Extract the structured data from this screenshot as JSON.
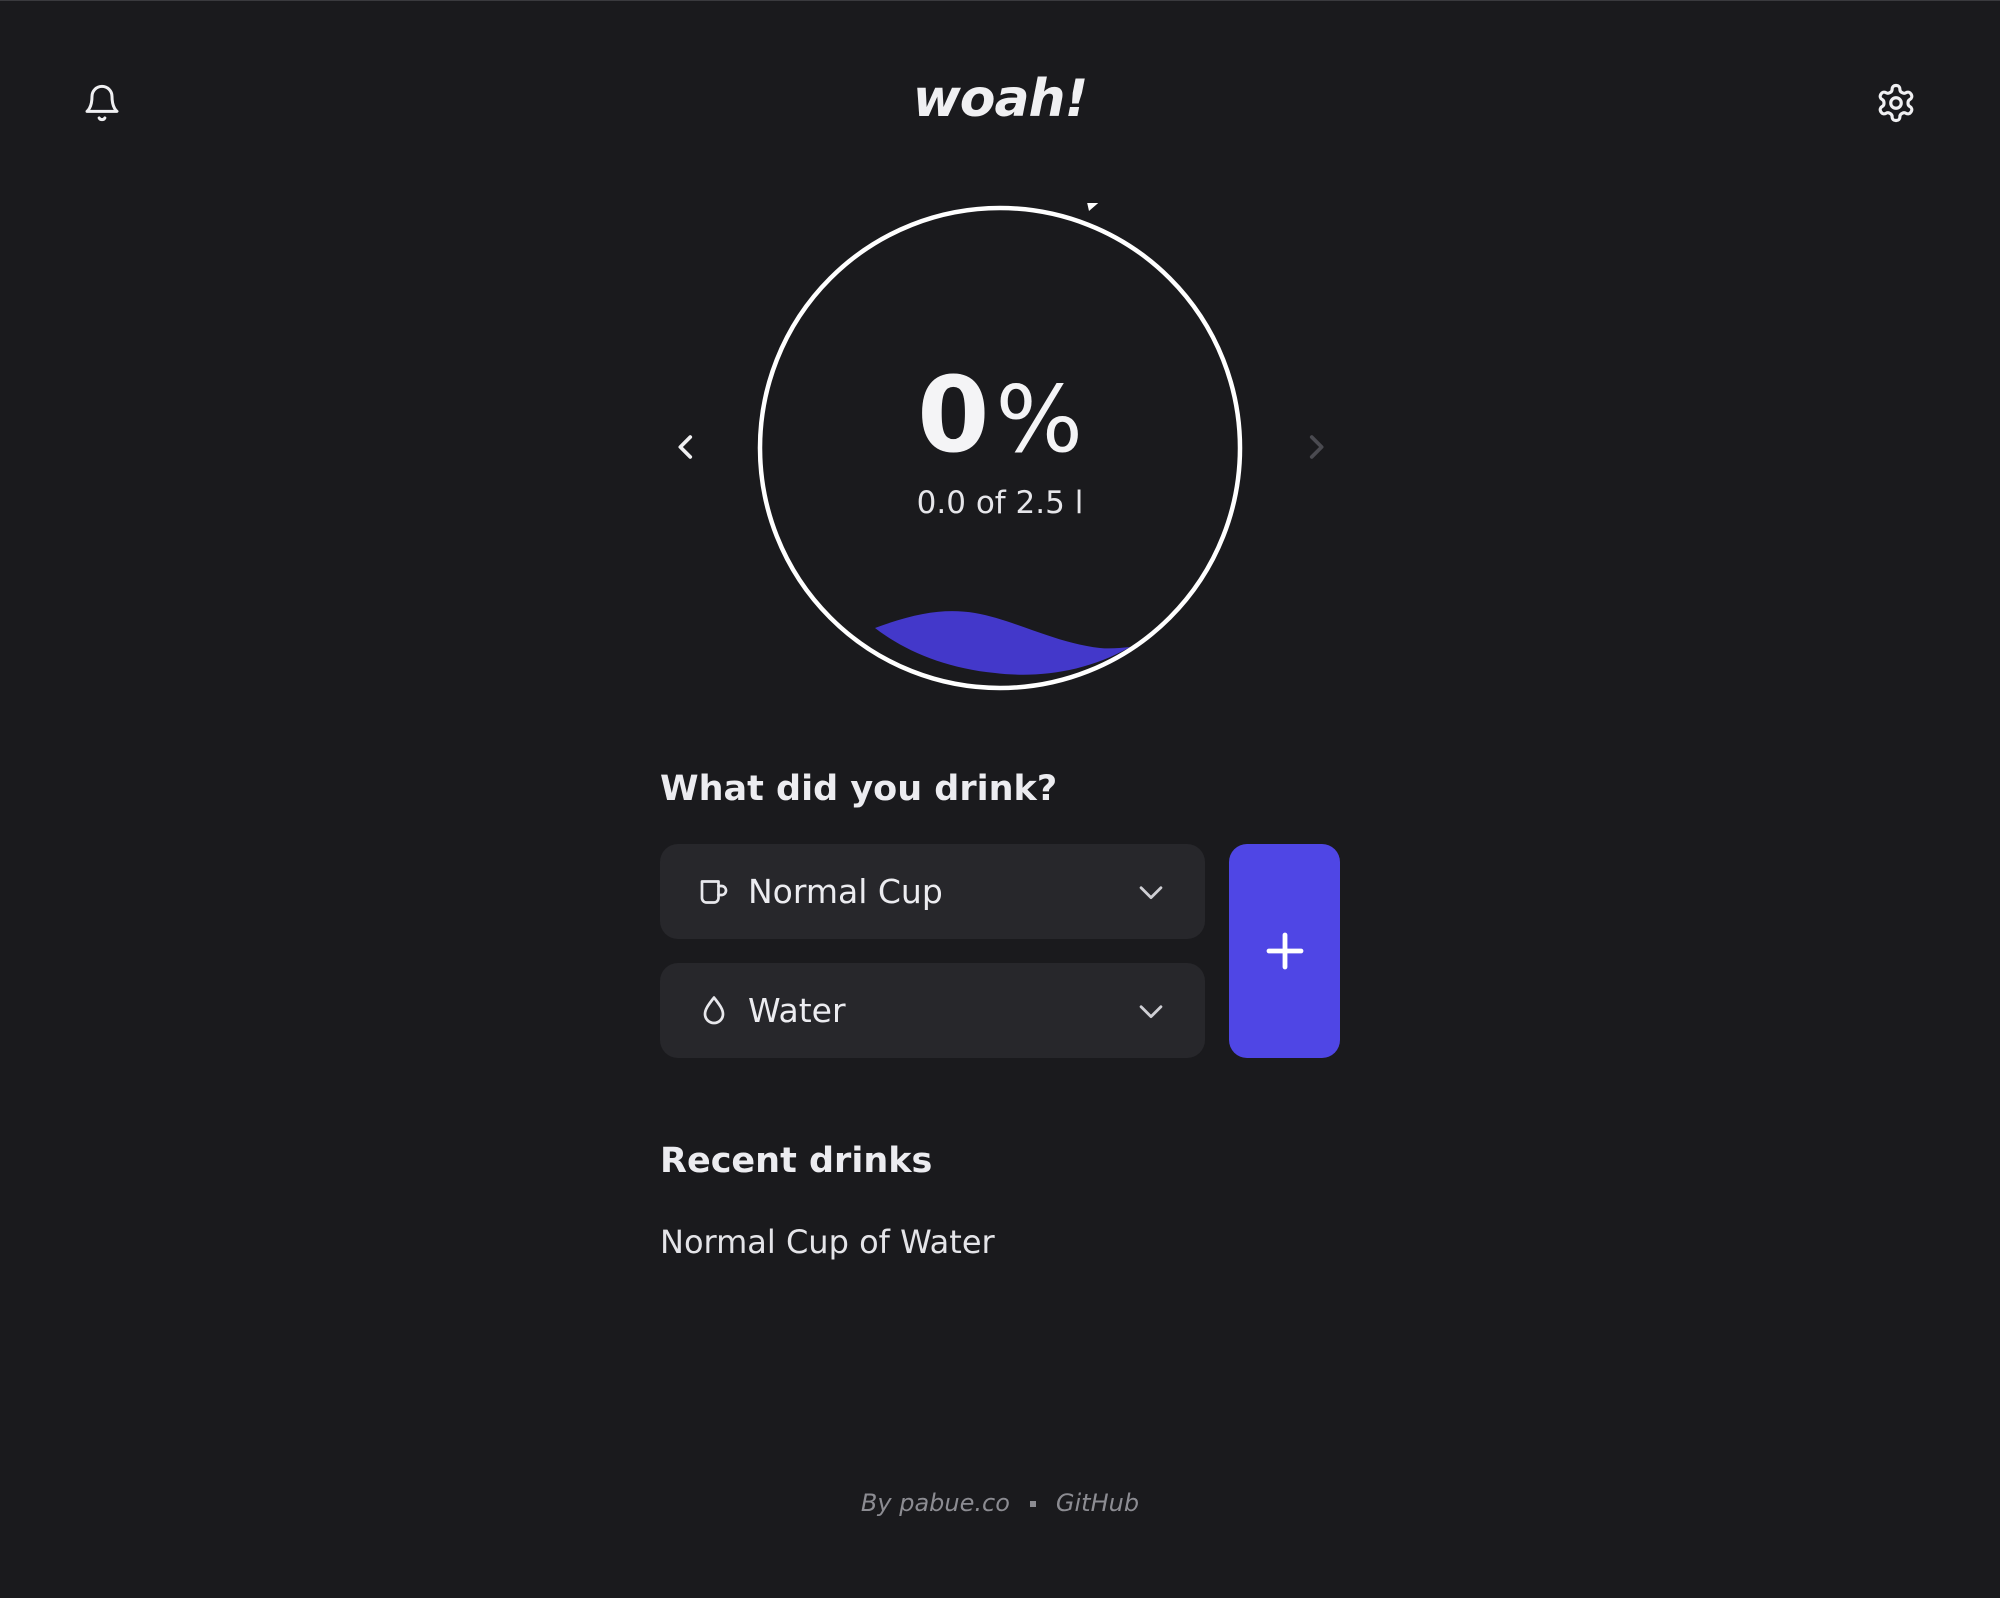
{
  "app": {
    "logo_text": "woah!"
  },
  "header": {
    "left_icon": "bell-icon",
    "right_icon": "gear-icon"
  },
  "progress": {
    "percent_value": "0",
    "percent_symbol": "%",
    "amount_text": "0.0 of 2.5 l",
    "fill_fraction": 0.0,
    "accent_color": "#4338ca",
    "ring_color": "#ffffff"
  },
  "nav": {
    "prev_icon": "chevron-left-icon",
    "next_icon": "chevron-right-icon",
    "next_disabled": true
  },
  "drink_form": {
    "question": "What did you drink?",
    "size_select": {
      "icon": "cup-icon",
      "value": "Normal Cup"
    },
    "type_select": {
      "icon": "droplet-icon",
      "value": "Water"
    },
    "add_button_icon": "plus-icon",
    "add_button_color": "#4f46e5"
  },
  "recent": {
    "title": "Recent drinks",
    "items": [
      "Normal Cup of Water"
    ]
  },
  "footer": {
    "author_text": "By pabue.co",
    "github_text": "GitHub"
  }
}
